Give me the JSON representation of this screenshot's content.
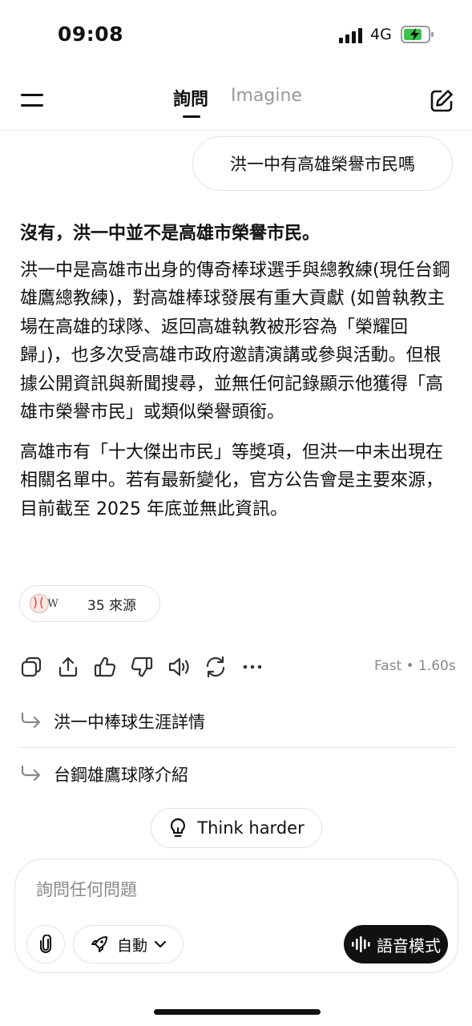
{
  "status_bar": {
    "time": "09:08",
    "network": "4G"
  },
  "header": {
    "tab_ask": "詢問",
    "tab_imagine": "Imagine"
  },
  "user_message": "洪一中有高雄榮譽市民嗎",
  "answer": {
    "lead": "沒有，洪一中並不是高雄市榮譽市民。",
    "paragraph1": "洪一中是高雄市出身的傳奇棒球選手與總教練(現任台鋼雄鷹總教練)，對高雄棒球發展有重大貢獻 (如曾執教主場在高雄的球隊、返回高雄執教被形容為「榮耀回歸」)，也多次受高雄市政府邀請演講或參與活動。但根據公開資訊與新聞搜尋，並無任何記錄顯示他獲得「高雄市榮譽市民」或類似榮譽頭銜。",
    "paragraph2": "高雄市有「十大傑出市民」等獎項，但洪一中未出現在相關名單中。若有最新變化，官方公告會是主要來源，目前截至 2025 年底並無此資訊。"
  },
  "sources": {
    "wiki_glyph": "W",
    "count_label": "35 來源"
  },
  "response_meta": "Fast • 1.60s",
  "followups": [
    "洪一中棒球生涯詳情",
    "台鋼雄鷹球隊介紹"
  ],
  "think_harder": "Think harder",
  "composer": {
    "placeholder": "詢問任何問題",
    "mode_label": "自動",
    "voice_label": "語音模式"
  },
  "icons": {
    "menu": "menu-icon",
    "compose": "compose-icon",
    "copy": "copy-icon",
    "share": "share-icon",
    "thumbs_up": "thumbs-up-icon",
    "thumbs_down": "thumbs-down-icon",
    "speaker": "speaker-icon",
    "regenerate": "regenerate-icon",
    "more": "more-icon",
    "attach": "paperclip-icon",
    "rocket": "rocket-icon",
    "bulb": "lightbulb-icon",
    "voice": "waveform-icon"
  },
  "colors": {
    "battery_charge": "#3bc44b",
    "muted_text": "#8a8a8a",
    "voice_button": "#111111"
  }
}
